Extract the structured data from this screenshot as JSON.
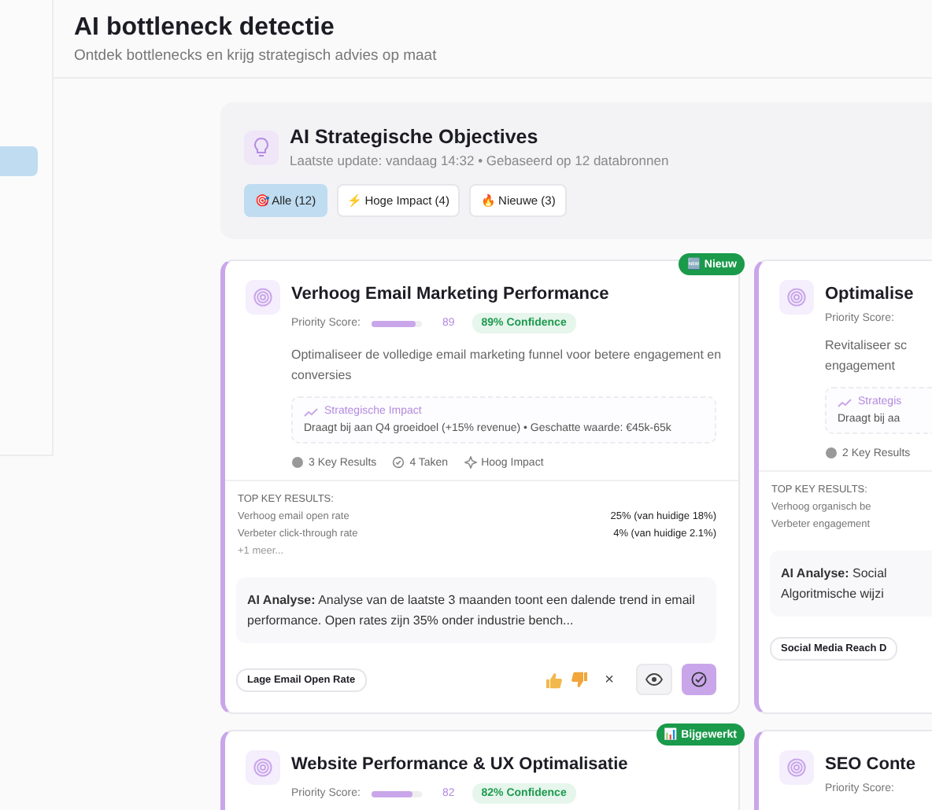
{
  "sidebar": {
    "items": [
      {
        "selected": true
      }
    ]
  },
  "header": {
    "title": "AI bottleneck detectie",
    "subtitle": "Ontdek bottlenecks en krijg strategisch advies op maat"
  },
  "objectives": {
    "title": "AI Strategische Objectives",
    "subtitle": "Laatste update: vandaag 14:32 • Gebaseerd op 12 databronnen",
    "filters": [
      {
        "label": "🎯 Alle (12)",
        "selected": true
      },
      {
        "label": "⚡ Hoge Impact (4)",
        "selected": false
      },
      {
        "label": "🔥 Nieuwe (3)",
        "selected": false
      }
    ]
  },
  "cards": [
    {
      "badge": "🆕 Nieuw",
      "title": "Verhoog Email Marketing Performance",
      "priority_label": "Priority Score:",
      "level": 0.89,
      "score": "89",
      "confidence": "89% Confidence",
      "description": [
        "Optimaliseer de volledige email marketing funnel voor betere engagement en",
        "conversies"
      ],
      "impact": {
        "title": "Strategische Impact",
        "text": "Draagt bij aan Q4 groeidoel (+15% revenue) • Geschatte waarde: €45k-65k"
      },
      "meta": [
        {
          "kind": "results",
          "label": "3 Key Results"
        },
        {
          "kind": "tasks",
          "label": "4 Taken"
        },
        {
          "kind": "impact",
          "label": "Hoog Impact"
        }
      ],
      "key_results": {
        "title": "TOP KEY RESULTS:",
        "rows": [
          {
            "name": "Verhoog email open rate",
            "value": "25% (van huidige 18%)"
          },
          {
            "name": "Verbeter click-through rate",
            "value": "4% (van huidige 2.1%)"
          }
        ],
        "more": "+1 meer..."
      },
      "analysis": {
        "label": "AI Analyse:",
        "lines": [
          "Analyse van de laatste 3 maanden toont een dalende trend in email",
          "performance. Open rates zijn 35% onder industrie bench..."
        ]
      },
      "tag": "Lage Email Open Rate",
      "dismiss": "×"
    },
    {
      "title": "Optimalise",
      "priority_label": "Priority Score:",
      "description": [
        "Revitaliseer sc",
        "engagement"
      ],
      "impact": {
        "title": "Strategis",
        "text": "Draagt bij aa"
      },
      "meta": [
        {
          "kind": "results",
          "label": "2 Key Results"
        }
      ],
      "key_results": {
        "title": "TOP KEY RESULTS:",
        "rows": [
          {
            "name": "Verhoog organisch be"
          },
          {
            "name": "Verbeter engagement"
          }
        ]
      },
      "analysis": {
        "label": "AI Analyse:",
        "lines": [
          "Social",
          "Algoritmische wijzi"
        ]
      },
      "tag": "Social Media Reach D"
    },
    {
      "badge": "📊 Bijgewerkt",
      "title": "Website Performance & UX Optimalisatie",
      "priority_label": "Priority Score:",
      "level": 0.82,
      "score": "82",
      "confidence": "82% Confidence"
    },
    {
      "title": "SEO Conte",
      "priority_label": "Priority Score:"
    }
  ]
}
